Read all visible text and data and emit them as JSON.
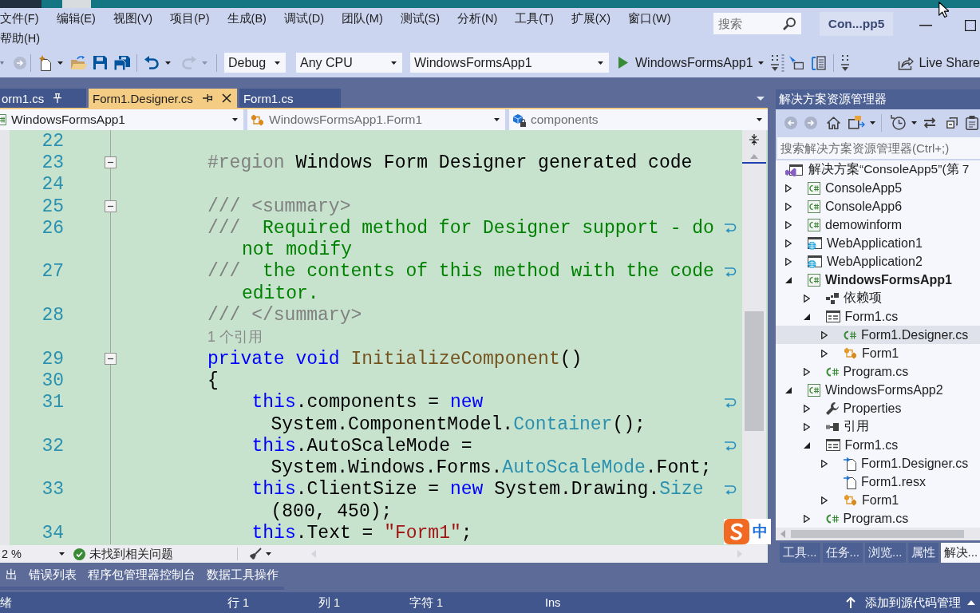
{
  "menu_bar": {
    "items": [
      "文件(F)",
      "编辑(E)",
      "视图(V)",
      "项目(P)",
      "生成(B)",
      "调试(D)",
      "团队(M)",
      "测试(S)",
      "分析(N)",
      "工具(T)",
      "扩展(X)",
      "窗口(W)",
      "帮助(H)"
    ],
    "search": {
      "placeholder": "搜索"
    },
    "solution_name": "Con...pp5"
  },
  "toolbar": {
    "navigate_forward": {
      "disabled": true
    },
    "undo": {
      "disabled": false
    },
    "redo": {
      "disabled": true
    },
    "configuration": "Debug",
    "platform": "Any CPU",
    "startup_project": "WindowsFormsApp1",
    "start_button": "WindowsFormsApp1",
    "live_share": "Live Share"
  },
  "document_tabs": [
    {
      "label": "orm1.cs",
      "selected": false,
      "pinned": true
    },
    {
      "label": "Form1.Designer.cs",
      "selected": true,
      "pinned": false
    },
    {
      "label": "Form1.cs",
      "selected": false,
      "pinned": false
    }
  ],
  "navigation_bar": {
    "project": "WindowsFormsApp1",
    "type": "WindowsFormsApp1.Form1",
    "member": "components"
  },
  "editor": {
    "lines": [
      {
        "kind": "code",
        "number": "22"
      },
      {
        "kind": "code",
        "number": "23",
        "collapsed": false,
        "segments": [
          {
            "kind": "directive",
            "text": "#region"
          },
          {
            "kind": "plain",
            "text": " Windows Form Designer generated code"
          }
        ]
      },
      {
        "kind": "code",
        "number": "24"
      },
      {
        "kind": "code",
        "number": "25",
        "collapsed": false,
        "segments": [
          {
            "kind": "doc_tag",
            "text": "/// <summary>"
          }
        ]
      },
      {
        "kind": "code",
        "number": "26",
        "segments": [
          {
            "kind": "doc_tag",
            "text": "///"
          },
          {
            "kind": "comment",
            "text": "  Required method for Designer support - do"
          }
        ],
        "wrap": [
          {
            "kind": "comment",
            "text": "not modify"
          }
        ]
      },
      {
        "kind": "code",
        "number": "27",
        "segments": [
          {
            "kind": "doc_tag",
            "text": "///"
          },
          {
            "kind": "comment",
            "text": "  the contents of this method with the code"
          }
        ],
        "wrap": [
          {
            "kind": "comment",
            "text": "editor."
          }
        ]
      },
      {
        "kind": "code",
        "number": "28",
        "segments": [
          {
            "kind": "doc_tag",
            "text": "/// </summary>"
          }
        ]
      },
      {
        "kind": "codelens",
        "text": "1 个引用"
      },
      {
        "kind": "code",
        "number": "29",
        "collapsed": false,
        "segments": [
          {
            "kind": "keyword",
            "text": "private void"
          },
          {
            "kind": "method",
            "text": " InitializeComponent"
          },
          {
            "kind": "plain",
            "text": "()"
          }
        ]
      },
      {
        "kind": "code",
        "number": "30",
        "segments": [
          {
            "kind": "plain",
            "text": "{"
          }
        ],
        "children": [
          {
            "kind": "code",
            "number": "31",
            "segments": [
              {
                "kind": "keyword",
                "text": "this"
              },
              {
                "kind": "plain",
                "text": ".components = "
              },
              {
                "kind": "keyword",
                "text": "new"
              }
            ],
            "wrap": [
              {
                "kind": "plain",
                "text": "System.ComponentModel."
              },
              {
                "kind": "type",
                "text": "Container"
              },
              {
                "kind": "plain",
                "text": "();"
              }
            ]
          },
          {
            "kind": "code",
            "number": "32",
            "segments": [
              {
                "kind": "keyword",
                "text": "this"
              },
              {
                "kind": "plain",
                "text": ".AutoScaleMode ="
              }
            ],
            "wrap": [
              {
                "kind": "plain",
                "text": "System.Windows.Forms."
              },
              {
                "kind": "type",
                "text": "AutoScaleMode"
              },
              {
                "kind": "plain",
                "text": ".Font;"
              }
            ]
          },
          {
            "kind": "code",
            "number": "33",
            "segments": [
              {
                "kind": "keyword",
                "text": "this"
              },
              {
                "kind": "plain",
                "text": ".ClientSize = "
              },
              {
                "kind": "keyword",
                "text": "new"
              },
              {
                "kind": "plain",
                "text": " System.Drawing."
              },
              {
                "kind": "type",
                "text": "Size"
              }
            ],
            "wrap": [
              {
                "kind": "plain",
                "text": "(800, 450);"
              }
            ]
          },
          {
            "kind": "code",
            "number": "34",
            "segments": [
              {
                "kind": "keyword",
                "text": "this"
              },
              {
                "kind": "plain",
                "text": ".Text = "
              },
              {
                "kind": "string",
                "text": "\"Form1\""
              },
              {
                "kind": "plain",
                "text": ";"
              }
            ]
          }
        ]
      }
    ],
    "input_method": "中"
  },
  "editor_status": {
    "zoom": "2 %",
    "issues": "未找到相关问题"
  },
  "solution_explorer": {
    "title": "解决方案资源管理器",
    "search": {
      "placeholder": "搜索解决方案资源管理器(Ctrl+;)"
    },
    "tree": [
      {
        "kind": "solution",
        "label": "解决方案“ConsoleApp5”(第 7",
        "selected": false,
        "children": [
          {
            "kind": "project",
            "label": "ConsoleApp5",
            "expanded": false,
            "selected": false,
            "startup": false
          },
          {
            "kind": "project",
            "label": "ConsoleApp6",
            "expanded": false,
            "selected": false,
            "startup": false
          },
          {
            "kind": "project",
            "label": "demowinform",
            "expanded": false,
            "selected": false,
            "startup": false
          },
          {
            "kind": "web_project",
            "label": "WebApplication1",
            "expanded": false,
            "selected": false,
            "startup": false
          },
          {
            "kind": "web_project",
            "label": "WebApplication2",
            "expanded": false,
            "selected": false,
            "startup": false
          },
          {
            "kind": "project",
            "label": "WindowsFormsApp1",
            "expanded": true,
            "selected": false,
            "startup": true,
            "children": [
              {
                "kind": "dependencies",
                "label": "依赖项",
                "expanded": false,
                "selected": false
              },
              {
                "kind": "form",
                "label": "Form1.cs",
                "expanded": true,
                "selected": false,
                "children": [
                  {
                    "kind": "cs_file",
                    "label": "Form1.Designer.cs",
                    "expanded": false,
                    "selected": true
                  },
                  {
                    "kind": "class",
                    "label": "Form1",
                    "expanded": false,
                    "selected": false
                  }
                ]
              },
              {
                "kind": "cs_file",
                "label": "Program.cs",
                "expanded": false,
                "selected": false
              }
            ]
          },
          {
            "kind": "project",
            "label": "WindowsFormsApp2",
            "expanded": true,
            "selected": false,
            "startup": false,
            "children": [
              {
                "kind": "properties",
                "label": "Properties",
                "expanded": false,
                "selected": false
              },
              {
                "kind": "references",
                "label": "引用",
                "expanded": false,
                "selected": false
              },
              {
                "kind": "form",
                "label": "Form1.cs",
                "expanded": true,
                "selected": false,
                "children": [
                  {
                    "kind": "linked_file",
                    "label": "Form1.Designer.cs",
                    "expanded": false,
                    "selected": false
                  },
                  {
                    "kind": "linked_file",
                    "label": "Form1.resx",
                    "selected": false
                  },
                  {
                    "kind": "class",
                    "label": "Form1",
                    "expanded": false,
                    "selected": false
                  }
                ]
              },
              {
                "kind": "cs_file",
                "label": "Program.cs",
                "expanded": false,
                "selected": false
              }
            ]
          }
        ]
      }
    ],
    "tabs": [
      {
        "label": "工具...",
        "selected": false
      },
      {
        "label": "任务...",
        "selected": false
      },
      {
        "label": "浏览...",
        "selected": false
      },
      {
        "label": "属性",
        "selected": false
      },
      {
        "label": "解决...",
        "selected": true
      }
    ]
  },
  "tool_window_tabs": [
    {
      "label": "出",
      "selected": false
    },
    {
      "label": "错误列表",
      "selected": false
    },
    {
      "label": "程序包管理器控制台",
      "selected": false
    },
    {
      "label": "数据工具操作",
      "selected": false
    }
  ],
  "status_bar": {
    "message": "绪",
    "line": "行 1",
    "column": "列 1",
    "character": "字符 1",
    "mode": "Ins",
    "source_control": "添加到源代码管理"
  }
}
